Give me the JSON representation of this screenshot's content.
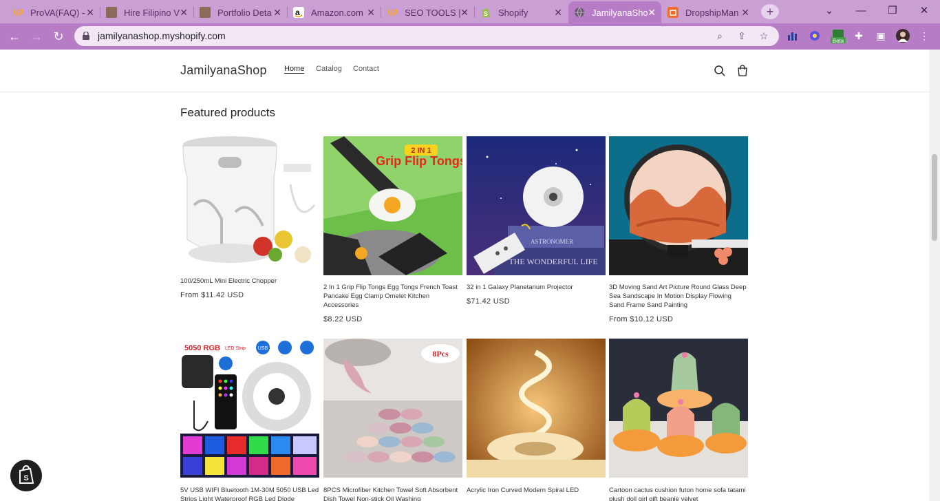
{
  "browser": {
    "tabs": [
      {
        "title": "ProVA(FAQ) -",
        "icon": "prova-favicon"
      },
      {
        "title": "Hire Filipino V",
        "icon": "avatar-favicon"
      },
      {
        "title": "Portfolio Deta",
        "icon": "avatar-favicon"
      },
      {
        "title": "Amazon.com",
        "icon": "amazon-favicon"
      },
      {
        "title": "SEO TOOLS |",
        "icon": "prova-favicon"
      },
      {
        "title": "Shopify",
        "icon": "shopify-favicon"
      },
      {
        "title": "JamilyanaSho",
        "icon": "globe-favicon"
      },
      {
        "title": "DropshipMan",
        "icon": "dropship-favicon"
      }
    ],
    "url": "jamilyanashop.myshopify.com",
    "extension_badge": "Beta",
    "colors": {
      "tabbar": "#c99fd4",
      "toolbar": "#b77cc6",
      "omnibox": "#f3e7f6"
    }
  },
  "site": {
    "logo": "JamilyanaShop",
    "nav": [
      "Home",
      "Catalog",
      "Contact"
    ],
    "section_title": "Featured products"
  },
  "products": [
    {
      "name": "100/250mL Mini Electric Chopper",
      "price": "From $11.42 USD"
    },
    {
      "name": "2 In 1 Grip Flip Tongs Egg Tongs French Toast Pancake Egg Clamp Omelet Kitchen Accessories",
      "price": "$8.22 USD",
      "badge": "2 IN 1",
      "headline": "Grip Flip Tongs"
    },
    {
      "name": "32 in 1 Galaxy Planetarium Projector",
      "price": "$71.42 USD",
      "book_text": "ASTRONOMER",
      "book_text2": "THE WONDERFUL LIFE"
    },
    {
      "name": "3D Moving Sand Art Picture Round Glass Deep Sea Sandscape In Motion Display Flowing Sand Frame Sand Painting",
      "price": "From $10.12 USD"
    },
    {
      "name": "5V USB WIFI Bluetooth 1M-30M 5050 USB Led Strips Light Waterproof RGB Led Diode",
      "price": "",
      "strip_label": "5050 RGB",
      "strip_sub": "LED Strip",
      "usb_label": "USB"
    },
    {
      "name": "8PCS Microfiber Kitchen Towel Soft Absorbent Dish Towel Non-stick Oil Washing",
      "price": "",
      "badge": "8Pcs"
    },
    {
      "name": "Acrylic Iron Curved Modern Spiral LED",
      "price": ""
    },
    {
      "name": "Cartoon cactus cushion futon home sofa tatami plush doll girl gift beanie velvet",
      "price": ""
    }
  ]
}
